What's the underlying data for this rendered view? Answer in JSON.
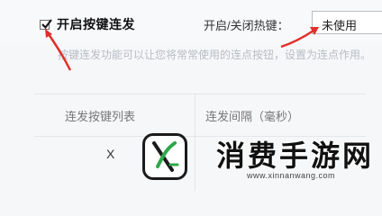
{
  "settings": {
    "enable_label": "开启按键连发",
    "enabled": true,
    "hotkey_label": "开启/关闭热键：",
    "hotkey_value": "未使用",
    "description": "按键连发功能可以让您将常常使用的连点按钮，设置为连点作用。"
  },
  "table": {
    "headers": [
      "连发按键列表",
      "连发间隔（毫秒）"
    ],
    "rows": [
      [
        "X",
        ""
      ]
    ]
  },
  "watermark": {
    "title": "消费手游网",
    "url": "www.xinnanwang.com"
  },
  "colors": {
    "arrow": "#e0302a",
    "accent_green": "#2ea84a"
  }
}
